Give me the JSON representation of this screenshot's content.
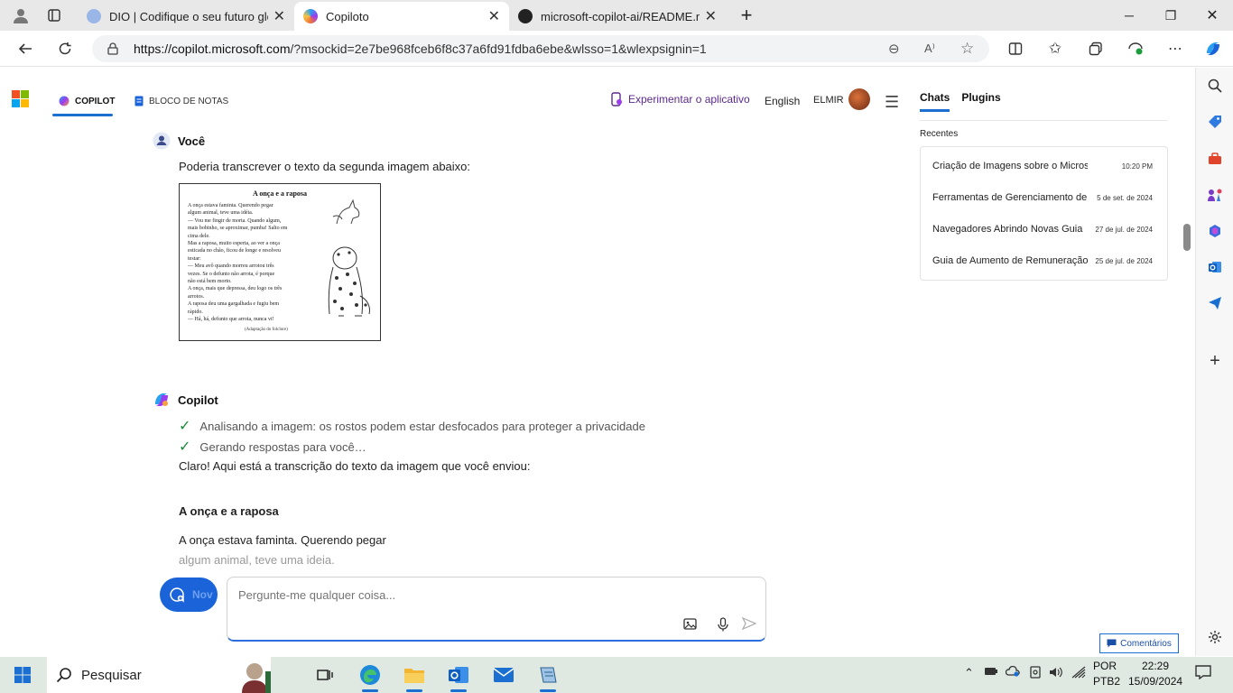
{
  "browser": {
    "tabs": [
      {
        "title": "DIO | Codifique o seu futuro glob",
        "active": false
      },
      {
        "title": "Copiloto",
        "active": true
      },
      {
        "title": "microsoft-copilot-ai/README.md",
        "active": false
      }
    ],
    "new_tab": "+",
    "url_host": "https://copilot.microsoft.com",
    "url_path": "/?msockid=2e7be968fceb6f8c37a6fd91fdba6ebe&wlsso=1&wlexpsignin=1"
  },
  "header": {
    "tab_copilot": "COPILOT",
    "tab_notebook": "BLOCO DE NOTAS",
    "try_app": "Experimentar o aplicativo",
    "language": "English",
    "user": "ELMIR"
  },
  "right_panel": {
    "tabs": [
      "Chats",
      "Plugins"
    ],
    "recent_label": "Recentes",
    "recent": [
      {
        "title": "Criação de Imagens sobre o Microsoft C",
        "date": "10:20 PM"
      },
      {
        "title": "Ferramentas de Gerenciamento de",
        "date": "5 de set. de 2024"
      },
      {
        "title": "Navegadores Abrindo Novas Guia",
        "date": "27 de jul. de 2024"
      },
      {
        "title": "Guia de Aumento de Remuneração",
        "date": "25 de jul. de 2024"
      }
    ]
  },
  "conversation": {
    "user_name": "Você",
    "user_message": "Poderia transcrever o texto da segunda imagem  abaixo:",
    "attachment": {
      "title": "A onça e a raposa",
      "lines": [
        "A onça estava faminta. Querendo pegar",
        "algum animal, teve uma idéia.",
        "— Vou me fingir de morta. Quando algum,",
        "mais bobinho, se aproximar, pumba! Salto em",
        "cima dele.",
        "Mas a raposa, muito esperta, ao ver a onça",
        "esticada no chão, ficou de longe e resolveu",
        "testar:",
        "— Meu avô quando morreu arrotou três",
        "vezes. Se o defunto não arrota, é porque",
        "não está bem morto.",
        "A onça, mais que depressa, deu logo os três",
        "arrotos.",
        "A raposa deu uma gargalhada e fugiu bem",
        "rápido.",
        "— Há, há, defunto que arrota, nunca vi!"
      ],
      "source": "(Adaptação do folclore)"
    },
    "bot_name": "Copilot",
    "steps": [
      "Analisando a imagem: os rostos podem estar desfocados para proteger a privacidade",
      "Gerando respostas para você…"
    ],
    "bot_intro": "Claro! Aqui está a transcrição do texto da imagem que você enviou:",
    "bot_heading": "A onça e a raposa",
    "bot_line1": "A onça estava faminta. Querendo pegar",
    "bot_line2": "algum animal, teve uma ideia."
  },
  "composer": {
    "new_topic": "Nov",
    "placeholder": "Pergunte-me qualquer coisa...",
    "feedback": "Comentários"
  },
  "taskbar": {
    "search": "Pesquisar",
    "lang1": "POR",
    "lang2": "PTB2",
    "time": "22:29",
    "date": "15/09/2024"
  },
  "colors": {
    "accent": "#1a6fd0",
    "purple": "#5b2a8c",
    "check": "#1a8c3b",
    "taskbar": "#dfe9e2"
  }
}
